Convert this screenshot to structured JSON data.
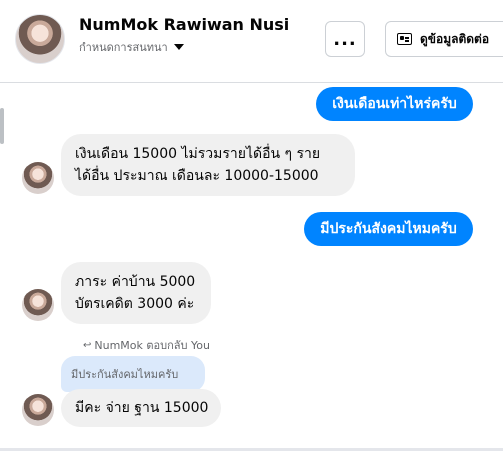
{
  "header": {
    "contact_name": "NumMok Rawiwan Nusi",
    "subtitle": "กำหนดการสนทนา",
    "more_label": "...",
    "info_label": "ดูข้อมูลติดต่อ"
  },
  "messages": [
    {
      "direction": "outgoing",
      "text": "เงินเดือนเท่าไหร่ครับ"
    },
    {
      "direction": "incoming",
      "lines": [
        "เงินเดือน 15000 ไม่รวมรายได้อื่น ๆ  ราย",
        "ได้อื่น ประมาณ     เดือนละ 10000-15000"
      ]
    },
    {
      "direction": "outgoing",
      "text": "มีประกันสังคมไหมครับ"
    },
    {
      "direction": "incoming",
      "lines": [
        "ภาระ ค่าบ้าน 5000",
        "บัตรเคดิต 3000 ค่ะ"
      ]
    },
    {
      "direction": "incoming",
      "reply_note": "NumMok ตอบกลับ You",
      "quoted": "มีประกันสังคมไหมครับ",
      "text": "มีคะ จ่าย ฐาน 15000"
    }
  ],
  "colors": {
    "outgoing_bubble": "#0084ff",
    "incoming_bubble": "#f0f0f0",
    "quoted_bubble": "#dbe9fb",
    "divider": "#dadde1"
  },
  "icons": [
    "more-icon",
    "contact-card-icon",
    "chevron-down-icon",
    "reply-arrow-icon"
  ]
}
